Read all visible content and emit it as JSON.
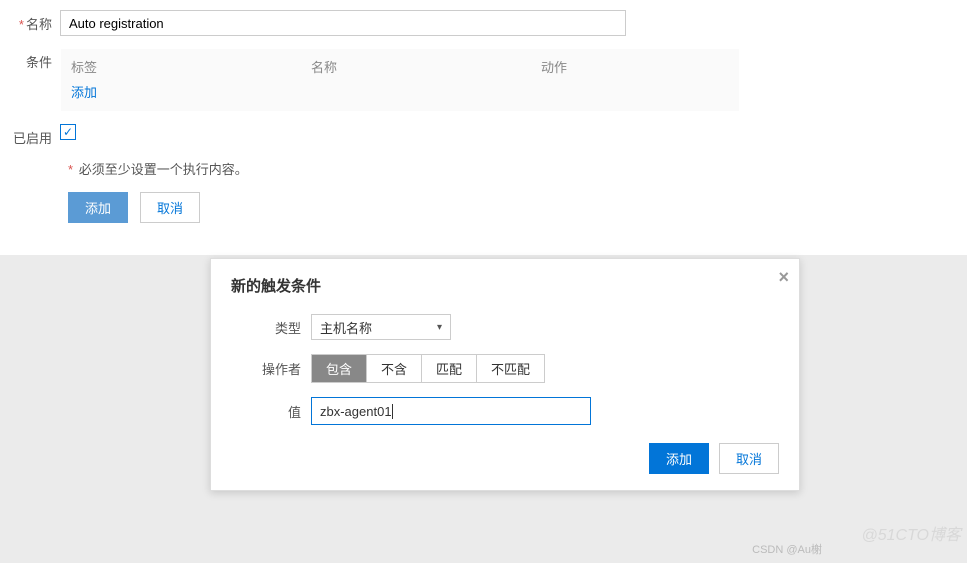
{
  "form": {
    "name_label": "名称",
    "name_value": "Auto registration",
    "cond_label": "条件",
    "cond_headers": {
      "tag": "标签",
      "name": "名称",
      "action": "动作"
    },
    "add_link": "添加",
    "enabled_label": "已启用",
    "note": "必须至少设置一个执行内容。",
    "add_btn": "添加",
    "cancel_btn": "取消"
  },
  "modal": {
    "title": "新的触发条件",
    "type_label": "类型",
    "type_value": "主机名称",
    "op_label": "操作者",
    "ops": {
      "contains": "包含",
      "not_contains": "不含",
      "match": "匹配",
      "not_match": "不匹配"
    },
    "val_label": "值",
    "val_value": "zbx-agent01",
    "add_btn": "添加",
    "cancel_btn": "取消"
  },
  "watermarks": {
    "w1": "@51CTO博客",
    "w2": "CSDN @Au榭"
  }
}
